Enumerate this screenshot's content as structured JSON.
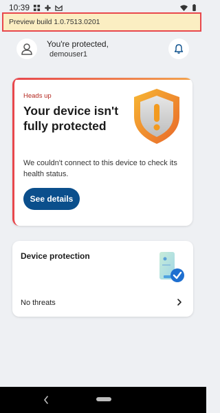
{
  "status_bar": {
    "time": "10:39",
    "left_icons": [
      "grid-icon",
      "fan-icon",
      "gmail-icon"
    ],
    "right_icons": [
      "wifi-icon",
      "battery-icon"
    ]
  },
  "banner": {
    "text": "Preview build 1.0.7513.0201"
  },
  "header": {
    "status_text": "You're protected,",
    "username": "demouser1"
  },
  "alert_card": {
    "label": "Heads up",
    "title": "Your device isn't fully protected",
    "body": "We couldn't connect to this device to check its health status.",
    "button_label": "See details",
    "accent_color": "#e8474c",
    "button_color": "#0b4f8c"
  },
  "protection_card": {
    "title": "Device protection",
    "status": "No threats"
  }
}
